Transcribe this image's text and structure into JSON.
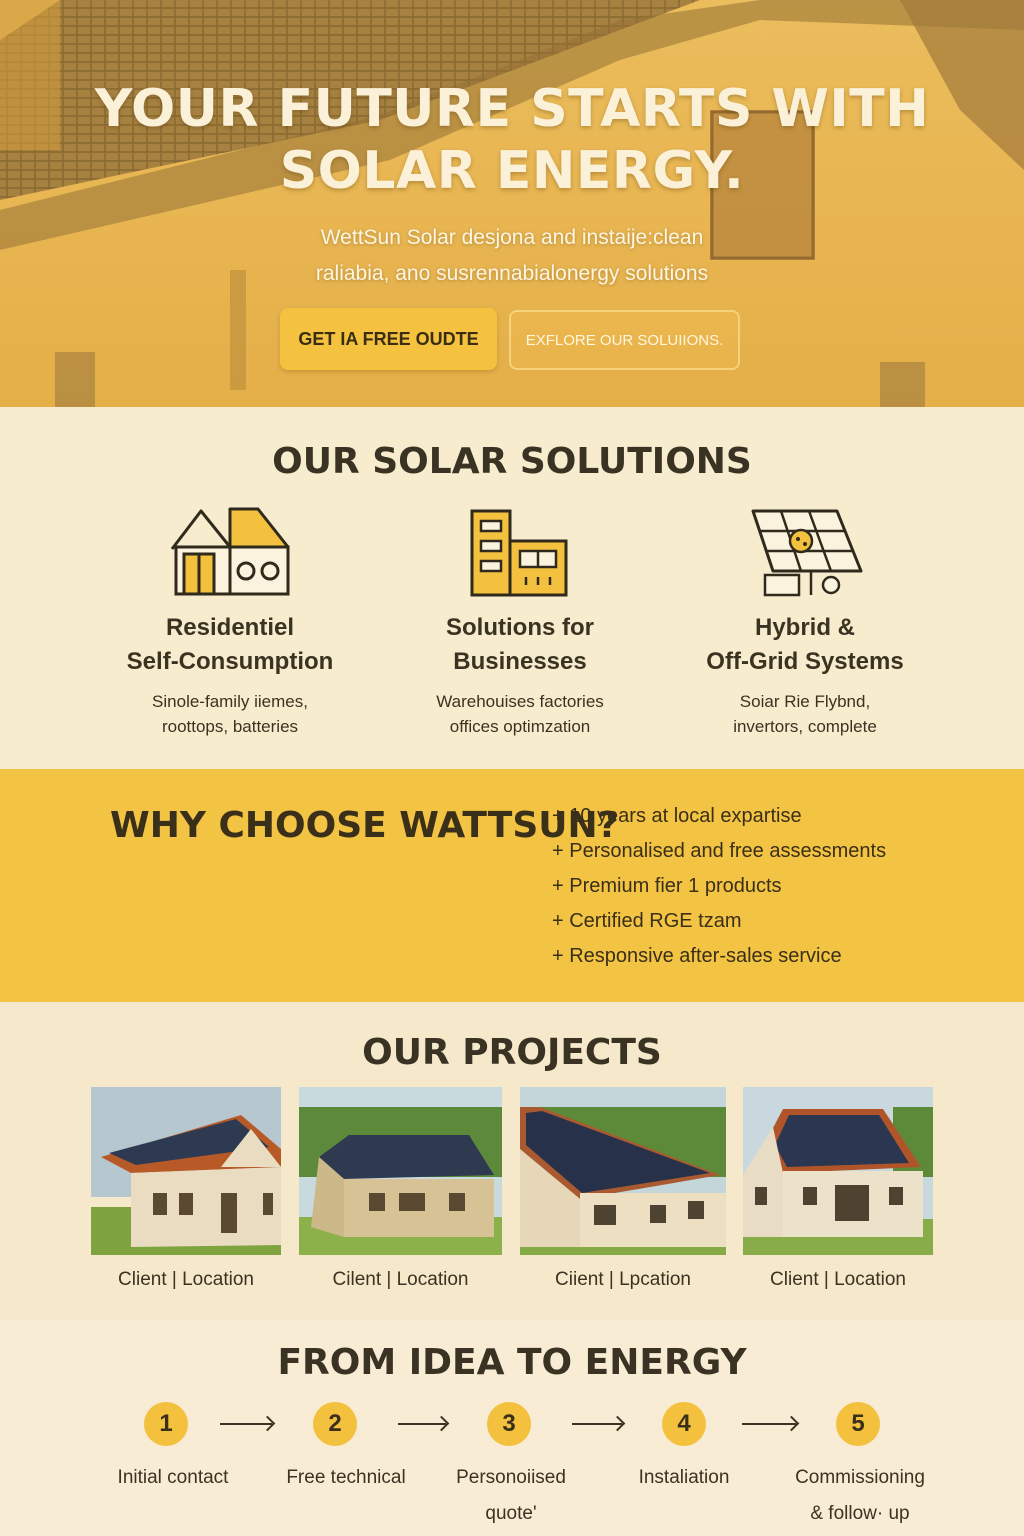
{
  "hero": {
    "title_line1": "YOUR FUTURE STARTS WITH",
    "title_line2": "SOLAR ENERGY.",
    "subtitle_line1": "WettSun Solar desjona and instaije:clean",
    "subtitle_line2": "raliabia, ano susrennabialonergy solutions",
    "primary_button": "GET IA FREE OUDTE",
    "secondary_button": "EXFLORE OUR SOLUIIONS."
  },
  "solutions": {
    "title": "OUR SOLAR SOLUTIONS",
    "items": [
      {
        "icon": "house-icon",
        "title_line1": "Residentiel",
        "title_line2": "Self-Consumption",
        "desc_line1": "Sinole-family iiemes,",
        "desc_line2": "roottops, batteries"
      },
      {
        "icon": "building-icon",
        "title_line1": "Solutions for",
        "title_line2": "Businesses",
        "desc_line1": "Warehouises factories",
        "desc_line2": "offices optimzation"
      },
      {
        "icon": "solar-panel-icon",
        "title_line1": "Hybrid &",
        "title_line2": "Off-Grid Systems",
        "desc_line1": "Soiar Rie Flybnd,",
        "desc_line2": "invertors, complete"
      }
    ]
  },
  "why": {
    "title": "WHY CHOOSE WATTSUN?",
    "items": [
      "+ 10 years at local expartise",
      "+ Personalised and free assessments",
      "+ Premium fier 1 products",
      "+ Certified RGE tzam",
      "+ Responsive after-sales service"
    ]
  },
  "projects": {
    "title": "OUR PROJECTS",
    "items": [
      {
        "caption": "Client | Location"
      },
      {
        "caption": "Cilent | Location"
      },
      {
        "caption": "Ciient | Lpcation"
      },
      {
        "caption": "Client | Location"
      }
    ]
  },
  "process": {
    "title": "FROM IDEA TO ENERGY",
    "steps": [
      {
        "number": "1",
        "label_line1": "Initial contact",
        "label_line2": ""
      },
      {
        "number": "2",
        "label_line1": "Free technical",
        "label_line2": ""
      },
      {
        "number": "3",
        "label_line1": "Personoiised",
        "label_line2": "quote'"
      },
      {
        "number": "4",
        "label_line1": "Instaliation",
        "label_line2": ""
      },
      {
        "number": "5",
        "label_line1": "Commissioning",
        "label_line2": "& follow· up"
      }
    ]
  },
  "colors": {
    "accent": "#f3c343",
    "background": "#f6e8cb",
    "text": "#3a3324"
  }
}
